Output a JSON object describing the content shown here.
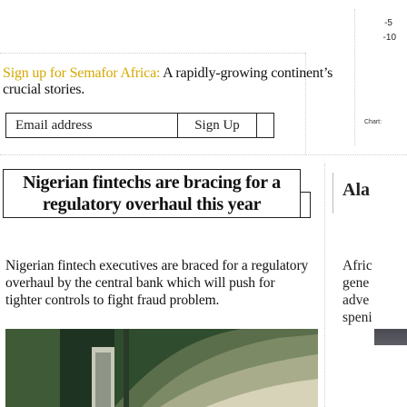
{
  "side_panel": {
    "top_number": "-5",
    "second_number": "-10",
    "chart_label": "Chart:"
  },
  "signup": {
    "brand_link": "Sign up for Semafor Africa:",
    "pitch": " A rapidly-growing continent’s crucial stories.",
    "email_placeholder": "Email address",
    "button_label": "Sign Up"
  },
  "story": {
    "headline": "Nigerian fintechs are bracing for a regulatory overhaul this year",
    "summary": "Nigerian fintech executives are braced for a regulatory overhaul by the central bank which will push for tighter controls to fight fraud problem."
  },
  "next_story": {
    "headline_fragment": "Ala",
    "summary_lines": [
      "Afric",
      "gene",
      "adve",
      "speni"
    ]
  },
  "colors": {
    "brand": "#d4a800",
    "text": "#111111",
    "border": "#222222"
  }
}
